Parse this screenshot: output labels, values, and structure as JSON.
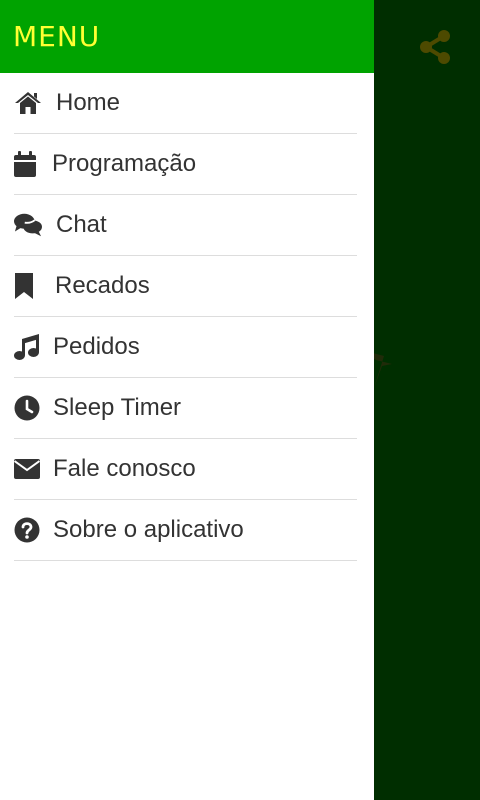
{
  "drawer": {
    "title": "MENU",
    "items": [
      {
        "label": "Home",
        "icon": "home-icon"
      },
      {
        "label": "Programação",
        "icon": "calendar-icon"
      },
      {
        "label": "Chat",
        "icon": "chat-icon"
      },
      {
        "label": "Recados",
        "icon": "bookmark-icon"
      },
      {
        "label": "Pedidos",
        "icon": "music-note-icon"
      },
      {
        "label": "Sleep Timer",
        "icon": "clock-icon"
      },
      {
        "label": "Fale conosco",
        "icon": "envelope-icon"
      },
      {
        "label": "Sobre o aplicativo",
        "icon": "question-circle-icon"
      }
    ]
  },
  "background": {
    "share_icon": "share-icon"
  },
  "colors": {
    "header_bg": "#00a300",
    "header_text": "#ffff33",
    "backdrop": "#002e00",
    "item_text": "#333333",
    "divider": "#dddddd",
    "share_icon": "#4d4a00"
  }
}
